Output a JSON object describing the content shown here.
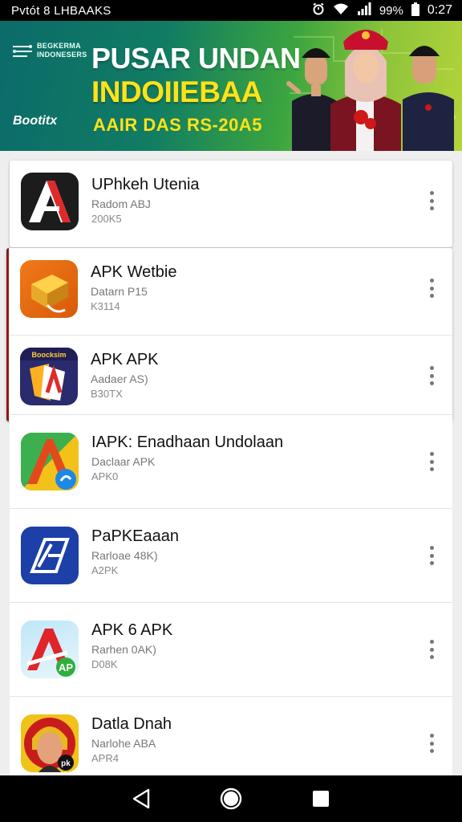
{
  "status_bar": {
    "left_text": "Pvtót 8 LHBAAKS",
    "battery_percent": "99%",
    "time": "0:27"
  },
  "banner": {
    "logo_line1": "BEGKERMA",
    "logo_line2": "INDONESERS",
    "title_line1": "PUSAR UNDAN",
    "title_line2": "INDOIIEBAA",
    "subtitle": "AAIR DAS RS-20A5",
    "brand": "Bootitx"
  },
  "apps": [
    {
      "name": "UPhkeh Utenia",
      "sub": "Radom ABJ",
      "size": "200K5",
      "icon": "red-a-icon"
    },
    {
      "name": "APK Wetbie",
      "sub": "Datarn P15",
      "size": "K3114",
      "icon": "orange-box-icon"
    },
    {
      "name": "APK APK",
      "sub": "Aadaer AS)",
      "size": "B30TX",
      "icon": "purple-a-icon"
    },
    {
      "name": "IAPK: Enadhaan Undolaan",
      "sub": "Daclaar APK",
      "size": "APK0",
      "icon": "green-a-icon"
    },
    {
      "name": "PaPKEaaan",
      "sub": "Rarloae 48K)",
      "size": "A2PK",
      "icon": "blue-slash-icon"
    },
    {
      "name": "APK 6 APK",
      "sub": "Rarhen 0AK)",
      "size": "D08K",
      "icon": "red-green-a-icon"
    },
    {
      "name": "Datla Dnah",
      "sub": "Narlohe ABA",
      "size": "APR4",
      "icon": "portrait-icon"
    }
  ],
  "nav": {
    "back": "back-icon",
    "home": "home-icon",
    "recents": "recents-icon"
  }
}
